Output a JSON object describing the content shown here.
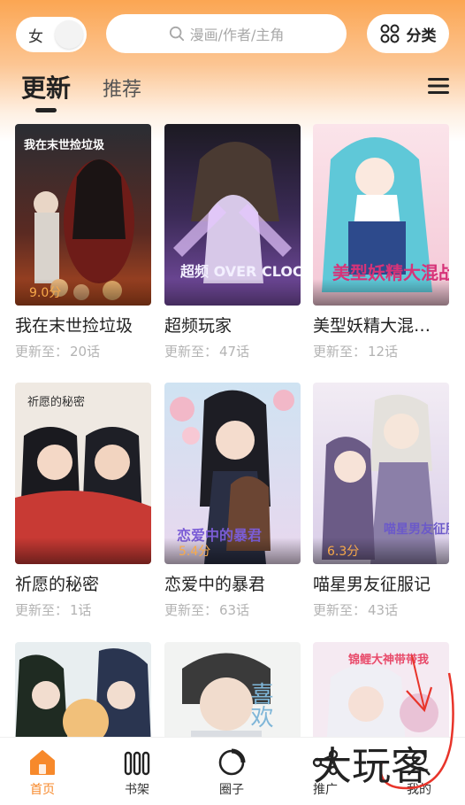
{
  "header": {
    "gender_label": "女",
    "search_placeholder": "漫画/作者/主角",
    "category_label": "分类"
  },
  "tabs": [
    {
      "label": "更新",
      "active": true
    },
    {
      "label": "推荐",
      "active": false
    }
  ],
  "comics": [
    {
      "title": "我在末世捡垃圾",
      "score": "9.0分",
      "update_prefix": "更新至：",
      "episodes": "20话",
      "cover_overlay_text": "我在末世捡垃圾"
    },
    {
      "title": "超频玩家",
      "score": "",
      "update_prefix": "更新至：",
      "episodes": "47话",
      "cover_overlay_text": "超频 OVER CLOCK"
    },
    {
      "title": "美型妖精大混…",
      "score": "",
      "update_prefix": "更新至：",
      "episodes": "12话",
      "cover_overlay_text": "美型妖精大混战"
    },
    {
      "title": "祈愿的秘密",
      "score": "",
      "update_prefix": "更新至：",
      "episodes": "1话",
      "cover_overlay_text": "祈愿的秘密"
    },
    {
      "title": "恋爱中的暴君",
      "score": "5.4分",
      "update_prefix": "更新至：",
      "episodes": "63话",
      "cover_overlay_text": "恋爱中的暴君"
    },
    {
      "title": "喵星男友征服记",
      "score": "6.3分",
      "update_prefix": "更新至：",
      "episodes": "43话",
      "cover_overlay_text": "喵星男友征服记"
    },
    {
      "title": "",
      "score": "",
      "update_prefix": "",
      "episodes": "",
      "cover_overlay_text": ""
    },
    {
      "title": "",
      "score": "",
      "update_prefix": "",
      "episodes": "",
      "cover_overlay_text": "喜欢"
    },
    {
      "title": "",
      "score": "",
      "update_prefix": "",
      "episodes": "",
      "cover_overlay_text": "锦鲤大神带带我"
    }
  ],
  "bottom_nav": [
    {
      "label": "首页",
      "icon": "home-icon",
      "active": true
    },
    {
      "label": "书架",
      "icon": "bookshelf-icon",
      "active": false
    },
    {
      "label": "圈子",
      "icon": "circle-icon",
      "active": false
    },
    {
      "label": "推广",
      "icon": "share-icon",
      "active": false
    },
    {
      "label": "我的",
      "icon": "profile-icon",
      "active": false
    }
  ],
  "annotation": {
    "handwritten_text": "大玩客"
  },
  "colors": {
    "accent": "#f7892b",
    "score": "#f7a94a",
    "header_gradient_top": "#fba653",
    "scribble": "#e8342a"
  }
}
